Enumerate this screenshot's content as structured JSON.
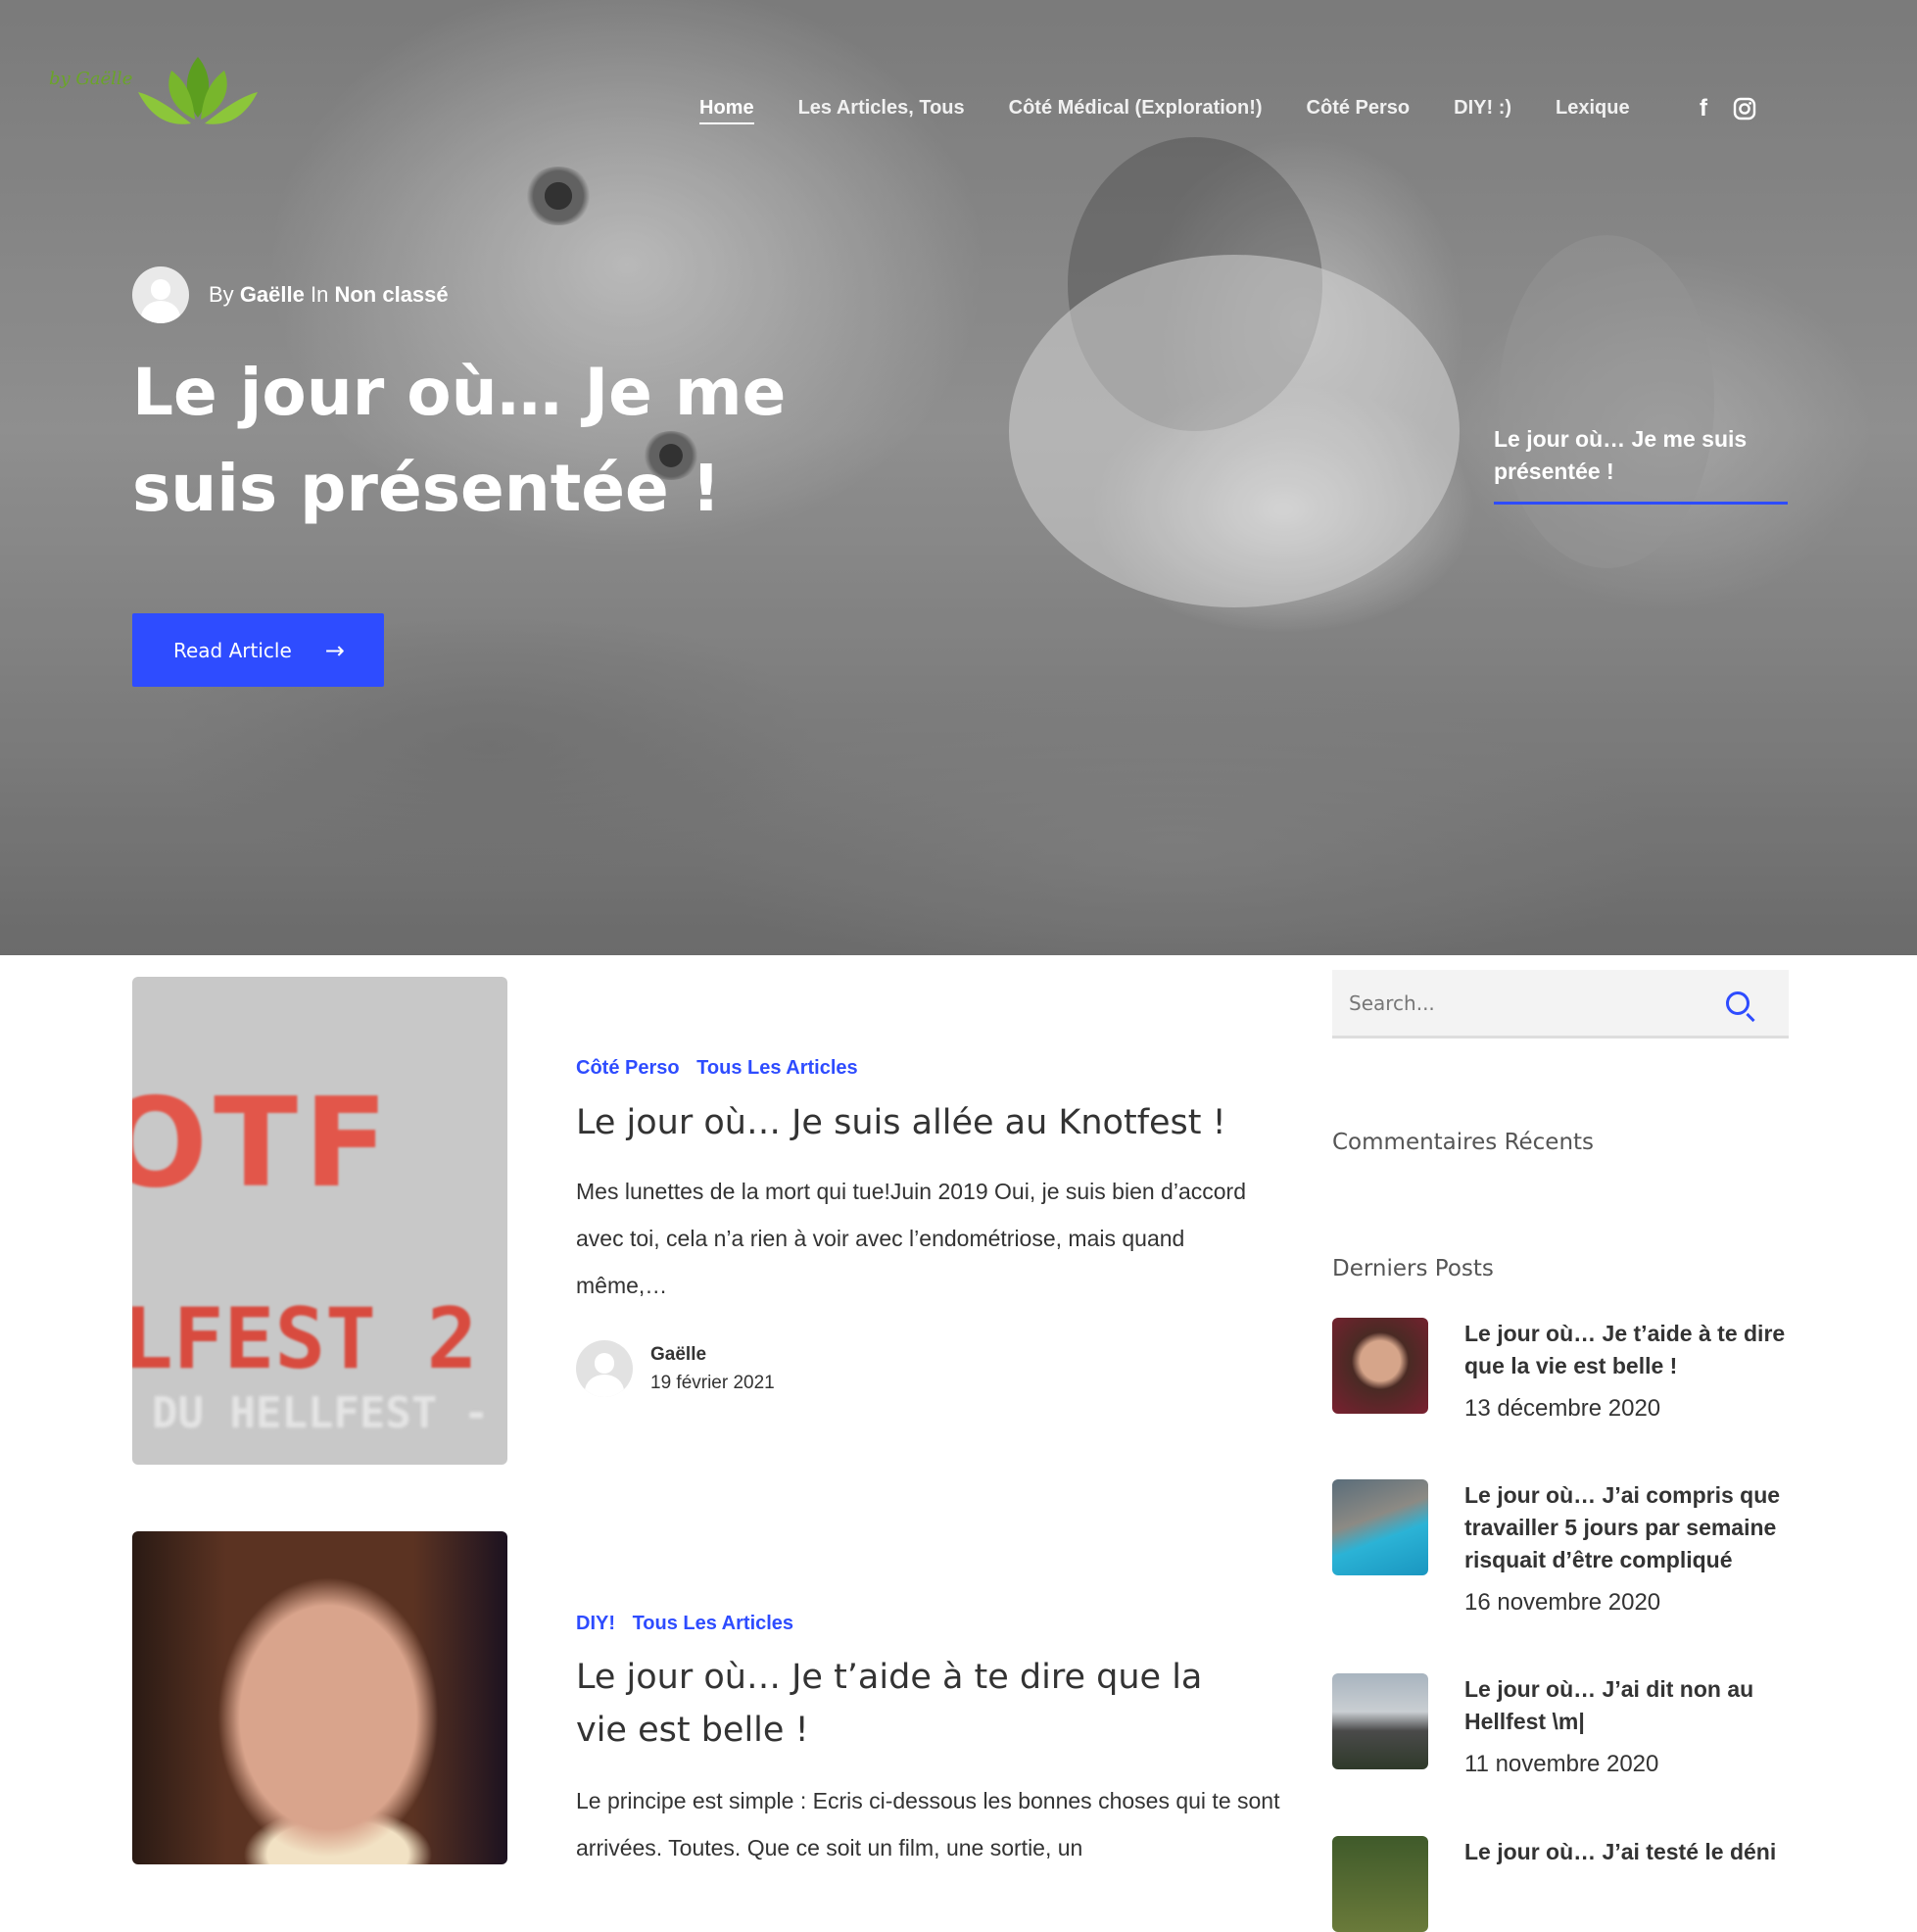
{
  "colors": {
    "accent": "#2e4cff",
    "logo_green": "#6aa527"
  },
  "header": {
    "logo_script": "by Gaëlle",
    "nav": [
      {
        "label": "Home",
        "active": true
      },
      {
        "label": "Les Articles, Tous"
      },
      {
        "label": "Côté Médical (Exploration!)"
      },
      {
        "label": "Côté Perso"
      },
      {
        "label": "DIY! :)"
      },
      {
        "label": "Lexique"
      }
    ],
    "social": [
      {
        "icon": "facebook-icon",
        "glyph": "f"
      },
      {
        "icon": "instagram-icon"
      }
    ]
  },
  "hero": {
    "by_label": "By",
    "author": "Gaëlle",
    "in_label": "In",
    "category": "Non classé",
    "title": "Le jour où… Je me suis présentée !",
    "button_label": "Read Article",
    "button_arrow": "→",
    "side_title": "Le jour où… Je me suis présentée !"
  },
  "posts": [
    {
      "categories": [
        "Côté Perso",
        "Tous Les Articles"
      ],
      "title": "Le jour où… Je suis allée au Knotfest !",
      "excerpt": "Mes lunettes de la mort qui tue!Juin 2019 Oui, je suis bien d’accord avec toi, cela n’a rien à voir avec l’endométriose, mais quand même,…",
      "author": "Gaëlle",
      "date": "19 février 2021",
      "thumb_text": [
        "OTF",
        "LFEST 2",
        "DU HELLFEST -"
      ]
    },
    {
      "categories": [
        "DIY!",
        "Tous Les Articles"
      ],
      "title": "Le jour où… Je t’aide à te dire que la vie est belle !",
      "excerpt": "Le principe est simple :   Ecris ci-dessous les bonnes choses qui te sont arrivées. Toutes. Que ce soit un film, une sortie, un"
    }
  ],
  "sidebar": {
    "search_placeholder": "Search...",
    "comments_title": "Commentaires Récents",
    "latest_title": "Derniers Posts",
    "latest": [
      {
        "title": "Le jour où… Je t’aide à te dire que la vie est belle !",
        "date": "13 décembre 2020"
      },
      {
        "title": "Le jour où… J’ai compris que travailler 5 jours par semaine risquait d’être compliqué",
        "date": "16 novembre 2020"
      },
      {
        "title": "Le jour où… J’ai dit non au Hellfest \\m|",
        "date": "11 novembre 2020"
      },
      {
        "title": "Le jour où… J’ai testé le déni",
        "date": ""
      }
    ]
  }
}
